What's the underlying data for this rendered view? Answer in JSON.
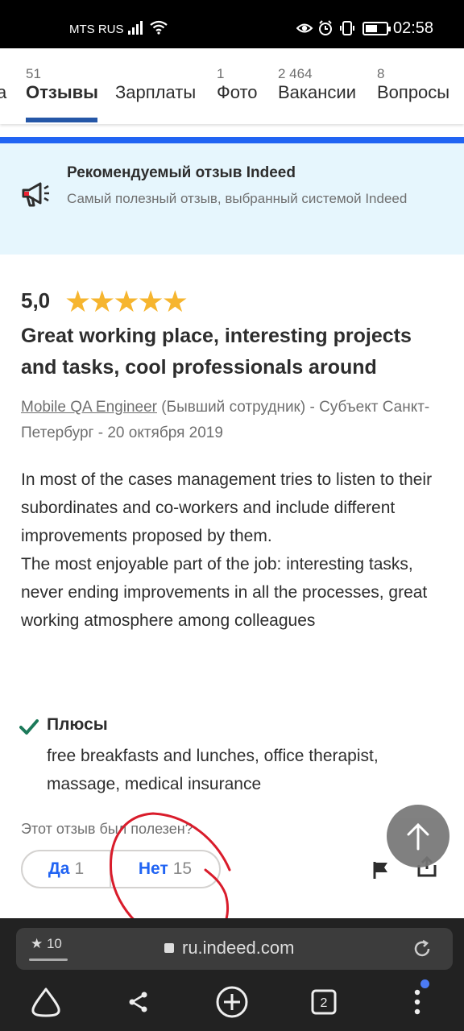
{
  "status_bar": {
    "carrier": "MTS RUS",
    "time": "02:58"
  },
  "tabs": [
    {
      "count": "",
      "label": "а",
      "active": false
    },
    {
      "count": "51",
      "label": "Отзывы",
      "active": true
    },
    {
      "count": "",
      "label": "Зарплаты",
      "active": false
    },
    {
      "count": "1",
      "label": "Фото",
      "active": false
    },
    {
      "count": "2 464",
      "label": "Вакансии",
      "active": false
    },
    {
      "count": "8",
      "label": "Вопросы",
      "active": false
    }
  ],
  "featured": {
    "title": "Рекомендуемый отзыв Indeed",
    "subtitle": "Самый полезный отзыв, выбранный системой Indeed",
    "icon": "megaphone-icon"
  },
  "review": {
    "rating": "5,0",
    "stars": 5,
    "title": "Great working place, interesting projects and tasks, cool professionals around",
    "job_title": "Mobile QA Engineer",
    "meta_rest": " (Бывший сотрудник) - Субъект Санкт-Петербург - 20 октября 2019",
    "body_p1": "In most of the cases management tries to listen to their subordinates and co-workers and include different improvements proposed by them.",
    "body_p2": "The most enjoyable part of the job: interesting tasks, never ending improvements in all the processes, great working atmosphere among colleagues",
    "pros_title": "Плюсы",
    "pros_text": "free breakfasts and lunches, office therapist, massage, medical insurance",
    "helpful_question": "Этот отзыв был полезен?",
    "vote_yes_label": "Да",
    "vote_yes_count": "1",
    "vote_no_label": "Нет",
    "vote_no_count": "15"
  },
  "browser": {
    "bookmark_count": "10",
    "url": "ru.indeed.com",
    "tab_count": "2"
  },
  "colors": {
    "accent": "#2164f3",
    "star": "#f6b52f",
    "featured_bg": "#e6f6fd",
    "check": "#1c7a5a",
    "annotation": "#d91c2b"
  }
}
